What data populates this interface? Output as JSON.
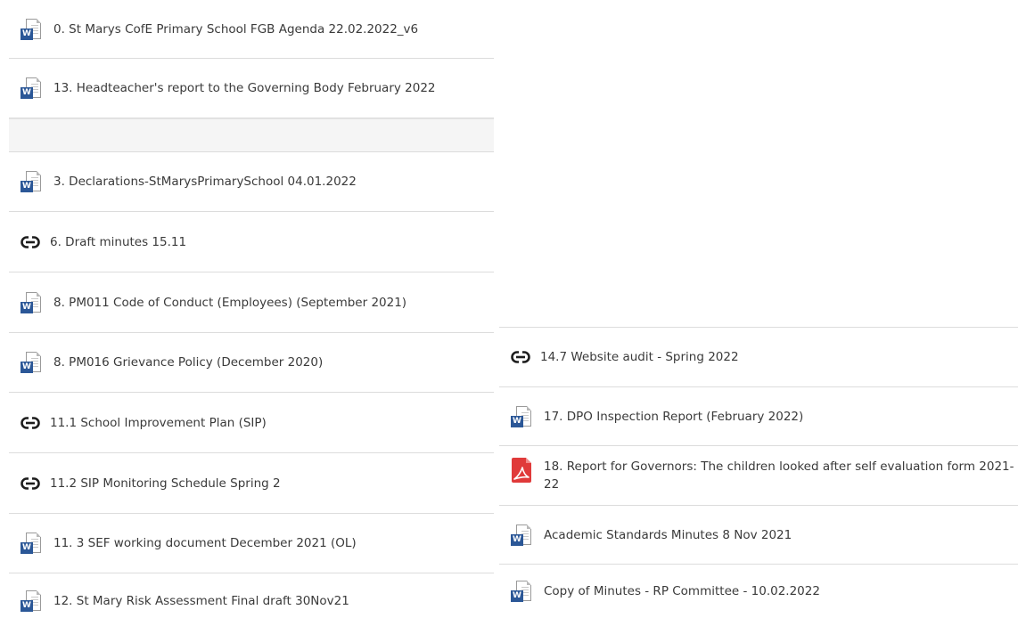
{
  "left_column": [
    {
      "type": "word",
      "label": "0. St Marys CofE Primary School FGB Agenda 22.02.2022_v6"
    },
    {
      "type": "word",
      "label": "13. Headteacher's report to the Governing Body February 2022"
    },
    {
      "type": "empty",
      "label": ""
    },
    {
      "type": "word",
      "label": "3. Declarations-StMarysPrimarySchool 04.01.2022"
    },
    {
      "type": "link",
      "label": "6. Draft minutes 15.11"
    },
    {
      "type": "word",
      "label": "8. PM011 Code of Conduct (Employees) (September 2021)"
    },
    {
      "type": "word",
      "label": "8. PM016 Grievance Policy (December 2020)"
    },
    {
      "type": "link",
      "label": "11.1 School Improvement Plan (SIP)"
    },
    {
      "type": "link",
      "label": "11.2 SIP Monitoring Schedule Spring 2"
    },
    {
      "type": "word",
      "label": "11. 3 SEF working document December 2021 (OL)"
    },
    {
      "type": "word",
      "label": "12. St Mary Risk Assessment Final draft 30Nov21"
    }
  ],
  "right_column": [
    {
      "type": "link",
      "label": "14.7 Website audit - Spring 2022"
    },
    {
      "type": "word",
      "label": "17. DPO Inspection Report (February 2022)"
    },
    {
      "type": "pdf",
      "label": "18. Report for Governors: The children looked after self evaluation form 2021-22"
    },
    {
      "type": "word",
      "label": "Academic Standards Minutes 8 Nov 2021"
    },
    {
      "type": "word",
      "label": "Copy of Minutes - RP Committee - 10.02.2022"
    }
  ],
  "icons": {
    "word": "word-document-icon",
    "link": "link-icon",
    "pdf": "pdf-document-icon"
  },
  "colors": {
    "word_badge": "#2b5797",
    "pdf_red": "#e03a3a",
    "link": "#1d1d1d",
    "text": "#3a3a3a",
    "divider": "#dcdcdc",
    "empty_row_bg": "#f5f5f5"
  }
}
